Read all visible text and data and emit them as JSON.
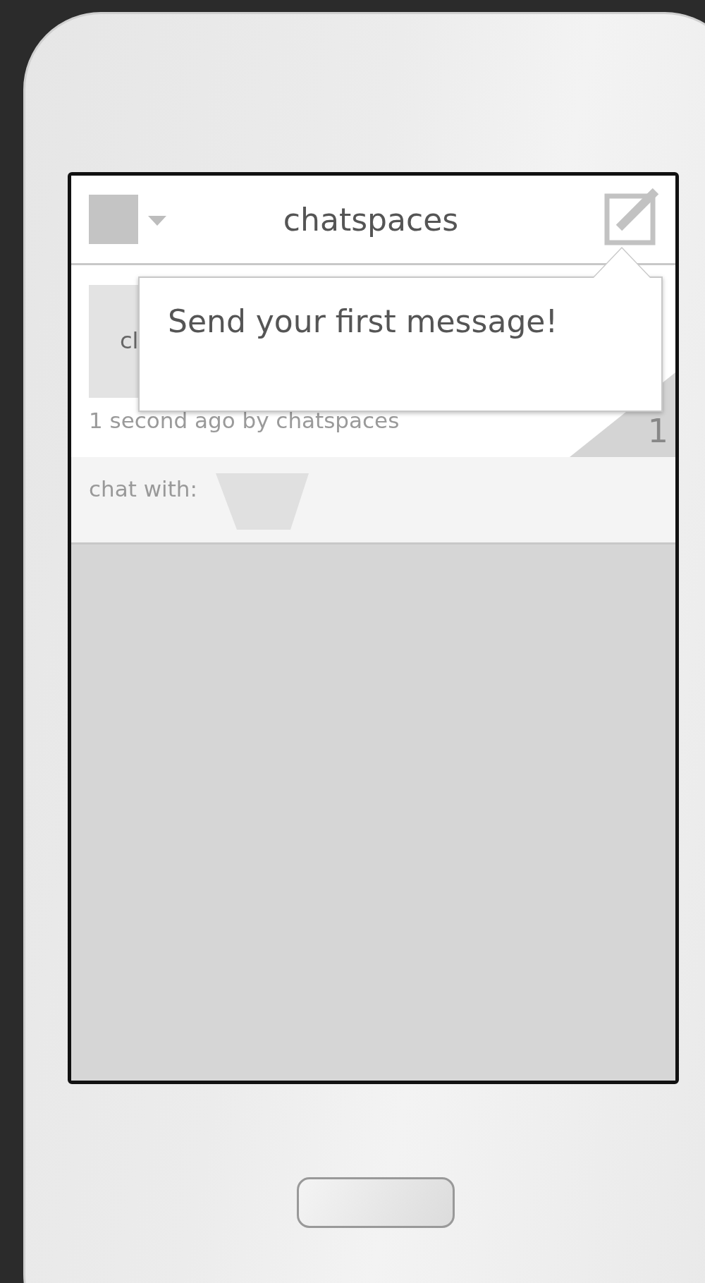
{
  "header": {
    "title": "chatspaces"
  },
  "chatspace": {
    "thumbnail_text": "cl",
    "meta": "1 second ago by chatspaces",
    "count": "1"
  },
  "chat_with": {
    "label": "chat with:"
  },
  "popup": {
    "text": "Send your first message!"
  }
}
